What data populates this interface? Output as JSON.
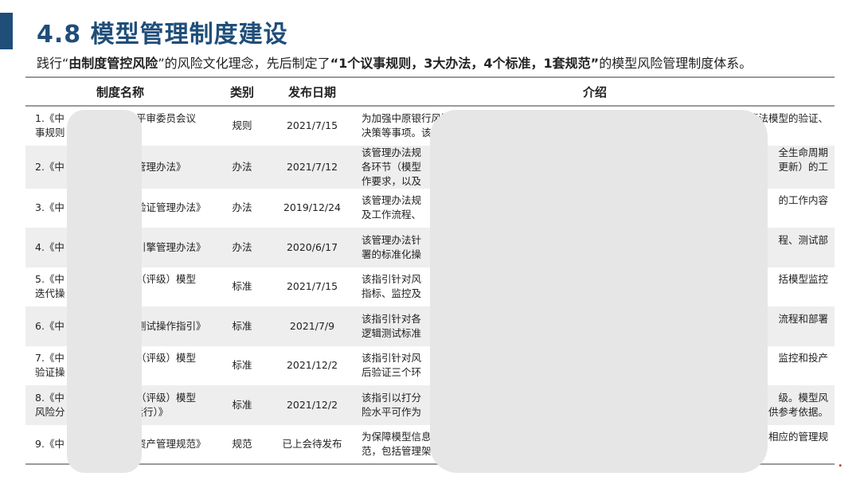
{
  "title": "4.8 模型管理制度建设",
  "intro": {
    "t1": "践行“",
    "b1": "由制度管控风险",
    "t2": "”的风险文化理念，先后制定了",
    "b2": "“1个议事规则，3大办法，4个标准，1套规范”",
    "t3": "的模型风险管理制度体系。"
  },
  "table": {
    "headers": [
      "制度名称",
      "类别",
      "发布日期",
      "介绍"
    ],
    "rows": [
      {
        "name_a": "1.《中",
        "name_b": "平审委员会议",
        "name_c": "事规则",
        "category": "规则",
        "date": "2021/7/15",
        "intro_a": "为加强中原银行风险",
        "intro_b": "算法模型的验证、",
        "intro_c": "决策等事项。该"
      },
      {
        "name_a": "2.《中",
        "name_b": "管理办法》",
        "name_c": "",
        "category": "办法",
        "date": "2021/7/12",
        "intro_a": "该管理办法规",
        "intro_b": "全生命周期",
        "intro_c": "各环节（模型",
        "intro_d": "更新）的工",
        "intro_e": "作要求，以及"
      },
      {
        "name_a": "3.《中",
        "name_b": "验证管理办法》",
        "name_c": "",
        "category": "办法",
        "date": "2019/12/24",
        "intro_a": "该管理办法规",
        "intro_b": "的工作内容",
        "intro_c": "及工作流程、"
      },
      {
        "name_a": "4.《中",
        "name_b": "引擎管理办法》",
        "name_c": "",
        "category": "办法",
        "date": "2020/6/17",
        "intro_a": "该管理办法针",
        "intro_b": "程、测试部",
        "intro_c": "署的标准化操"
      },
      {
        "name_a": "5.《中",
        "name_b": "（评级）模型",
        "name_c": "迭代操",
        "category": "标准",
        "date": "2021/7/15",
        "intro_a": "该指引针对风",
        "intro_b": "括模型监控",
        "intro_c": "指标、监控及"
      },
      {
        "name_a": "6.《中",
        "name_b": "测试操作指引》",
        "name_c": "",
        "category": "标准",
        "date": "2021/7/9",
        "intro_a": "该指引针对各",
        "intro_b": "流程和部署",
        "intro_c": "逻辑测试标准"
      },
      {
        "name_a": "7.《中",
        "name_b": "（评级）模型",
        "name_c": "验证操",
        "category": "标准",
        "date": "2021/12/2",
        "intro_a": "该指引针对风",
        "intro_b": "监控和投产",
        "intro_c": "后验证三个环"
      },
      {
        "name_a": "8.《中",
        "name_b": "（评级）模型",
        "name_c": "风险分",
        "name_d": "运行）》",
        "category": "标准",
        "date": "2021/12/2",
        "intro_a": "该指引以打分",
        "intro_b": "级。模型风",
        "intro_c": "险水平可作为",
        "intro_d": "供参考依据。"
      },
      {
        "name_a": "9.《中",
        "name_b": "资产管理规范》",
        "name_c": "",
        "category": "规范",
        "date": "已上会待发布",
        "intro_a": "为保障模型信息",
        "intro_b": "相应的管理规",
        "intro_c": "范，包括管理架构与"
      }
    ]
  },
  "colors": {
    "title": "#1f4e79",
    "accent_bar": "#1f4e79",
    "stripe": "#eeeeee",
    "rule": "#9a9a9a"
  }
}
